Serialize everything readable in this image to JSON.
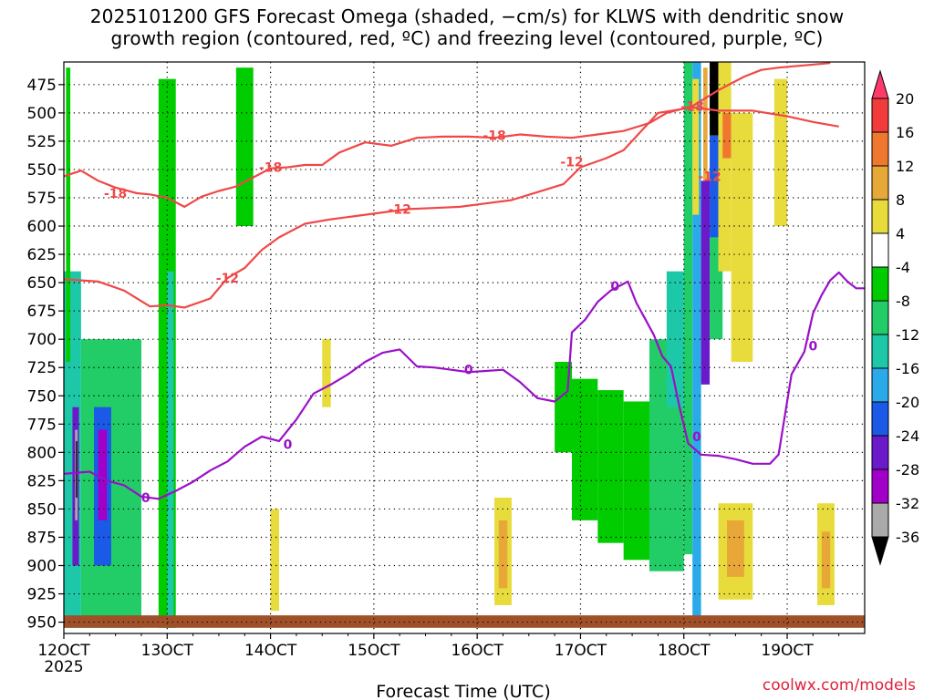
{
  "title": {
    "line1": "2025101200 GFS Forecast Omega (shaded, −cm/s) for KLWS with dendritic snow",
    "line2": "growth region (contoured, red, ºC) and freezing level (contoured, purple, ºC)"
  },
  "credit": "coolwx.com/models",
  "chart_data": {
    "type": "heatmap",
    "xlabel": "Forecast Time (UTC)",
    "x_ticks": [
      "12OCT",
      "13OCT",
      "14OCT",
      "15OCT",
      "16OCT",
      "17OCT",
      "18OCT",
      "19OCT"
    ],
    "x_year_label": "2025",
    "xlim_hours": [
      0,
      186
    ],
    "y_ticks": [
      475,
      500,
      525,
      550,
      575,
      600,
      625,
      650,
      675,
      700,
      725,
      750,
      775,
      800,
      825,
      850,
      875,
      900,
      925,
      950
    ],
    "ylim_hPa": [
      455,
      960
    ],
    "grid": true,
    "colorbar": {
      "labels": [
        "20",
        "16",
        "12",
        "8",
        "4",
        "-4",
        "-8",
        "-12",
        "-16",
        "-20",
        "-24",
        "-28",
        "-32",
        "-36"
      ],
      "bins": [
        {
          "color": "#ff3a6a"
        },
        {
          "color": "#f23c3c"
        },
        {
          "color": "#f0782e"
        },
        {
          "color": "#e8a838"
        },
        {
          "color": "#e8dc3c"
        },
        {
          "color": "#ffffff"
        },
        {
          "color": "#00cc00"
        },
        {
          "color": "#22cc66"
        },
        {
          "color": "#1dc8a8"
        },
        {
          "color": "#2aaae8"
        },
        {
          "color": "#1a5ae6"
        },
        {
          "color": "#6a1ac8"
        },
        {
          "color": "#a000c8"
        },
        {
          "color": "#aaaaaa"
        },
        {
          "color": "#000000"
        }
      ]
    },
    "contours": {
      "dgz_color": "#f04848",
      "freezing_color": "#9a10c8",
      "dgz_lines": [
        {
          "level": -18,
          "labels": [
            {
              "text": "-18",
              "x_hours": 12,
              "p": 571
            },
            {
              "text": "-18",
              "x_hours": 48,
              "p": 548
            },
            {
              "text": "-18",
              "x_hours": 100,
              "p": 520
            },
            {
              "text": "-18",
              "x_hours": 146,
              "p": 494
            }
          ],
          "points": [
            [
              0,
              556
            ],
            [
              4,
              551
            ],
            [
              8,
              560
            ],
            [
              12,
              566
            ],
            [
              17,
              571
            ],
            [
              20,
              572
            ],
            [
              24,
              575
            ],
            [
              28,
              583
            ],
            [
              32,
              574
            ],
            [
              36,
              569
            ],
            [
              40,
              565
            ],
            [
              44,
              557
            ],
            [
              48,
              549
            ],
            [
              52,
              548
            ],
            [
              56,
              546
            ],
            [
              60,
              546
            ],
            [
              64,
              535
            ],
            [
              70,
              526
            ],
            [
              76,
              529
            ],
            [
              82,
              522
            ],
            [
              88,
              521
            ],
            [
              94,
              521
            ],
            [
              100,
              522
            ],
            [
              106,
              519
            ],
            [
              112,
              521
            ],
            [
              118,
              522
            ],
            [
              124,
              519
            ],
            [
              130,
              516
            ],
            [
              136,
              509
            ],
            [
              140,
              500
            ],
            [
              146,
              494
            ],
            [
              152,
              480
            ],
            [
              158,
              468
            ],
            [
              162,
              462
            ],
            [
              166,
              460
            ],
            [
              172,
              458
            ],
            [
              178,
              456
            ]
          ]
        },
        {
          "level": -12,
          "labels": [
            {
              "text": "-12",
              "x_hours": 38,
              "p": 646
            },
            {
              "text": "-12",
              "x_hours": 78,
              "p": 585
            },
            {
              "text": "-12",
              "x_hours": 118,
              "p": 543
            },
            {
              "text": "-12",
              "x_hours": 150,
              "p": 556
            }
          ],
          "points": [
            [
              0,
              647
            ],
            [
              8,
              649
            ],
            [
              14,
              657
            ],
            [
              20,
              671
            ],
            [
              24,
              670
            ],
            [
              28,
              672
            ],
            [
              34,
              664
            ],
            [
              38,
              646
            ],
            [
              42,
              637
            ],
            [
              46,
              621
            ],
            [
              50,
              610
            ],
            [
              56,
              598
            ],
            [
              62,
              594
            ],
            [
              68,
              591
            ],
            [
              74,
              588
            ],
            [
              80,
              585
            ],
            [
              86,
              584
            ],
            [
              92,
              583
            ],
            [
              98,
              580
            ],
            [
              104,
              577
            ],
            [
              110,
              570
            ],
            [
              116,
              563
            ],
            [
              120,
              548
            ],
            [
              126,
              540
            ],
            [
              130,
              533
            ],
            [
              138,
              500
            ],
            [
              146,
              495
            ],
            [
              152,
              498
            ],
            [
              160,
              498
            ],
            [
              168,
              503
            ],
            [
              174,
              508
            ],
            [
              180,
              512
            ]
          ]
        }
      ],
      "freezing_line": {
        "level": 0,
        "labels": [
          {
            "text": "0",
            "x_hours": 19,
            "p": 840
          },
          {
            "text": "0",
            "x_hours": 52,
            "p": 793
          },
          {
            "text": "0",
            "x_hours": 94,
            "p": 727
          },
          {
            "text": "0",
            "x_hours": 128,
            "p": 653
          },
          {
            "text": "0",
            "x_hours": 147,
            "p": 786
          },
          {
            "text": "0",
            "x_hours": 174,
            "p": 706
          }
        ],
        "points": [
          [
            0,
            819
          ],
          [
            6,
            817
          ],
          [
            10,
            825
          ],
          [
            14,
            829
          ],
          [
            18,
            839
          ],
          [
            22,
            841
          ],
          [
            26,
            834
          ],
          [
            30,
            826
          ],
          [
            34,
            816
          ],
          [
            38,
            808
          ],
          [
            42,
            795
          ],
          [
            46,
            786
          ],
          [
            50,
            790
          ],
          [
            54,
            771
          ],
          [
            58,
            748
          ],
          [
            62,
            740
          ],
          [
            66,
            731
          ],
          [
            70,
            720
          ],
          [
            74,
            712
          ],
          [
            78,
            709
          ],
          [
            82,
            724
          ],
          [
            86,
            725
          ],
          [
            90,
            727
          ],
          [
            94,
            729
          ],
          [
            98,
            728
          ],
          [
            102,
            727
          ],
          [
            106,
            738
          ],
          [
            110,
            752
          ],
          [
            114,
            755
          ],
          [
            117,
            746
          ],
          [
            118,
            694
          ],
          [
            121,
            683
          ],
          [
            124,
            667
          ],
          [
            127,
            657
          ],
          [
            131,
            649
          ],
          [
            133,
            668
          ],
          [
            135,
            682
          ],
          [
            137,
            696
          ],
          [
            139,
            715
          ],
          [
            141,
            724
          ],
          [
            143,
            760
          ],
          [
            145,
            792
          ],
          [
            148,
            802
          ],
          [
            152,
            803
          ],
          [
            156,
            806
          ],
          [
            160,
            810
          ],
          [
            164,
            810
          ],
          [
            166,
            802
          ],
          [
            169,
            731
          ],
          [
            172,
            711
          ],
          [
            174,
            677
          ],
          [
            176,
            661
          ],
          [
            178,
            648
          ],
          [
            180,
            641
          ],
          [
            182,
            649
          ],
          [
            184,
            655
          ],
          [
            186,
            655
          ]
        ]
      }
    },
    "omega_cells": [
      {
        "x_hours": [
          0,
          4
        ],
        "p": [
          640,
          955
        ],
        "bin": 8
      },
      {
        "x_hours": [
          2,
          3.5
        ],
        "p": [
          760,
          900
        ],
        "bin": 11
      },
      {
        "x_hours": [
          2.6,
          3.2
        ],
        "p": [
          780,
          860
        ],
        "bin": 13
      },
      {
        "x_hours": [
          2.8,
          3.1
        ],
        "p": [
          790,
          840
        ],
        "bin": 14
      },
      {
        "x_hours": [
          4,
          18
        ],
        "p": [
          700,
          955
        ],
        "bin": 7
      },
      {
        "x_hours": [
          7,
          11
        ],
        "p": [
          760,
          900
        ],
        "bin": 10
      },
      {
        "x_hours": [
          8,
          10
        ],
        "p": [
          780,
          860
        ],
        "bin": 12
      },
      {
        "x_hours": [
          0.5,
          1.5
        ],
        "p": [
          460,
          720
        ],
        "bin": 6
      },
      {
        "x_hours": [
          22,
          26
        ],
        "p": [
          470,
          955
        ],
        "bin": 6
      },
      {
        "x_hours": [
          24,
          25.5
        ],
        "p": [
          640,
          955
        ],
        "bin": 8
      },
      {
        "x_hours": [
          40,
          44
        ],
        "p": [
          460,
          600
        ],
        "bin": 6
      },
      {
        "x_hours": [
          114,
          118
        ],
        "p": [
          720,
          800
        ],
        "bin": 6
      },
      {
        "x_hours": [
          118,
          124
        ],
        "p": [
          735,
          860
        ],
        "bin": 6
      },
      {
        "x_hours": [
          124,
          130
        ],
        "p": [
          745,
          880
        ],
        "bin": 6
      },
      {
        "x_hours": [
          130,
          136
        ],
        "p": [
          755,
          895
        ],
        "bin": 6
      },
      {
        "x_hours": [
          136,
          144
        ],
        "p": [
          700,
          905
        ],
        "bin": 7
      },
      {
        "x_hours": [
          140,
          144
        ],
        "p": [
          640,
          760
        ],
        "bin": 8
      },
      {
        "x_hours": [
          144,
          146
        ],
        "p": [
          455,
          890
        ],
        "bin": 7
      },
      {
        "x_hours": [
          146,
          148
        ],
        "p": [
          455,
          950
        ],
        "bin": 9
      },
      {
        "x_hours": [
          146,
          147.5
        ],
        "p": [
          470,
          590
        ],
        "bin": 4
      },
      {
        "x_hours": [
          148,
          150
        ],
        "p": [
          560,
          740
        ],
        "bin": 11
      },
      {
        "x_hours": [
          148.5,
          149.5
        ],
        "p": [
          460,
          560
        ],
        "bin": 3
      },
      {
        "x_hours": [
          150,
          152
        ],
        "p": [
          455,
          520
        ],
        "bin": 14
      },
      {
        "x_hours": [
          150,
          152
        ],
        "p": [
          520,
          610
        ],
        "bin": 10
      },
      {
        "x_hours": [
          150,
          153
        ],
        "p": [
          610,
          700
        ],
        "bin": 7
      },
      {
        "x_hours": [
          152,
          155
        ],
        "p": [
          455,
          640
        ],
        "bin": 4
      },
      {
        "x_hours": [
          153,
          155
        ],
        "p": [
          500,
          540
        ],
        "bin": 2
      },
      {
        "x_hours": [
          155,
          160
        ],
        "p": [
          500,
          720
        ],
        "bin": 4
      },
      {
        "x_hours": [
          165,
          168
        ],
        "p": [
          470,
          600
        ],
        "bin": 4
      },
      {
        "x_hours": [
          152,
          160
        ],
        "p": [
          845,
          930
        ],
        "bin": 4
      },
      {
        "x_hours": [
          154,
          158
        ],
        "p": [
          860,
          910
        ],
        "bin": 3
      },
      {
        "x_hours": [
          100,
          104
        ],
        "p": [
          840,
          935
        ],
        "bin": 4
      },
      {
        "x_hours": [
          101,
          103
        ],
        "p": [
          860,
          920
        ],
        "bin": 3
      },
      {
        "x_hours": [
          175,
          179
        ],
        "p": [
          845,
          935
        ],
        "bin": 4
      },
      {
        "x_hours": [
          176,
          178
        ],
        "p": [
          870,
          920
        ],
        "bin": 3
      },
      {
        "x_hours": [
          48,
          50
        ],
        "p": [
          850,
          940
        ],
        "bin": 4
      },
      {
        "x_hours": [
          186,
          188
        ],
        "p": [
          530,
          550
        ],
        "bin": 6
      },
      {
        "x_hours": [
          60,
          62
        ],
        "p": [
          700,
          760
        ],
        "bin": 4
      },
      {
        "x_hours": [
          130,
          132
        ],
        "p": [
          460,
          700
        ],
        "bin": 5
      },
      {
        "x_hours": [
          104,
          106
        ],
        "p": [
          460,
          700
        ],
        "bin": 5
      }
    ],
    "surface_band": {
      "p": [
        944,
        955
      ],
      "color": "#a05028"
    }
  }
}
